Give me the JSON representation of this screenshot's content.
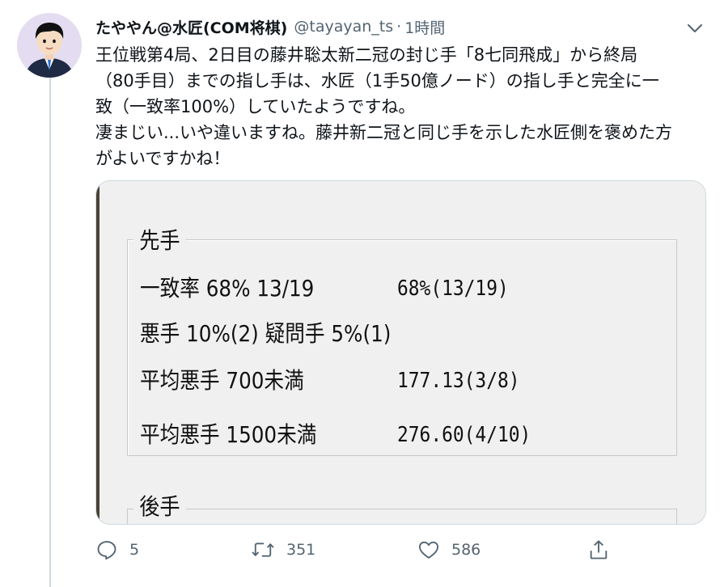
{
  "tweet": {
    "display_name": "たややん@水匠(COM将棋)",
    "handle": "@tayayan_ts",
    "separator": "·",
    "time": "1時間",
    "text_lines": [
      "王位戦第4局、2日目の藤井聡太新二冠の封じ手「8七同飛成」から終局",
      "（80手目）までの指し手は、水匠（1手50億ノード）の指し手と完全に一",
      "致（一致率100%）していたようですね。",
      "凄まじい...いや違いますね。藤井新二冠と同じ手を示した水匠側を褒めた方",
      "がよいですかね！"
    ]
  },
  "media": {
    "sente_label": "先手",
    "gote_label": "後手",
    "rows": [
      {
        "label": "一致率 68% 13/19",
        "value": "68%(13/19)"
      },
      {
        "label": "悪手 10%(2) 疑問手 5%(1)",
        "value": ""
      },
      {
        "label": "平均悪手 700未満",
        "value": "177.13(3/8)"
      },
      {
        "label": "平均悪手 1500未満",
        "value": "276.60(4/10)"
      }
    ]
  },
  "actions": {
    "reply_count": "5",
    "retweet_count": "351",
    "like_count": "586"
  },
  "icons": {
    "reply": "reply-icon",
    "retweet": "retweet-icon",
    "like": "heart-icon",
    "share": "share-icon",
    "caret": "chevron-down-icon"
  },
  "colors": {
    "text": "#0f1419",
    "secondary": "#536471",
    "border": "#cfd9de",
    "media_background": "#f0f0f0"
  }
}
